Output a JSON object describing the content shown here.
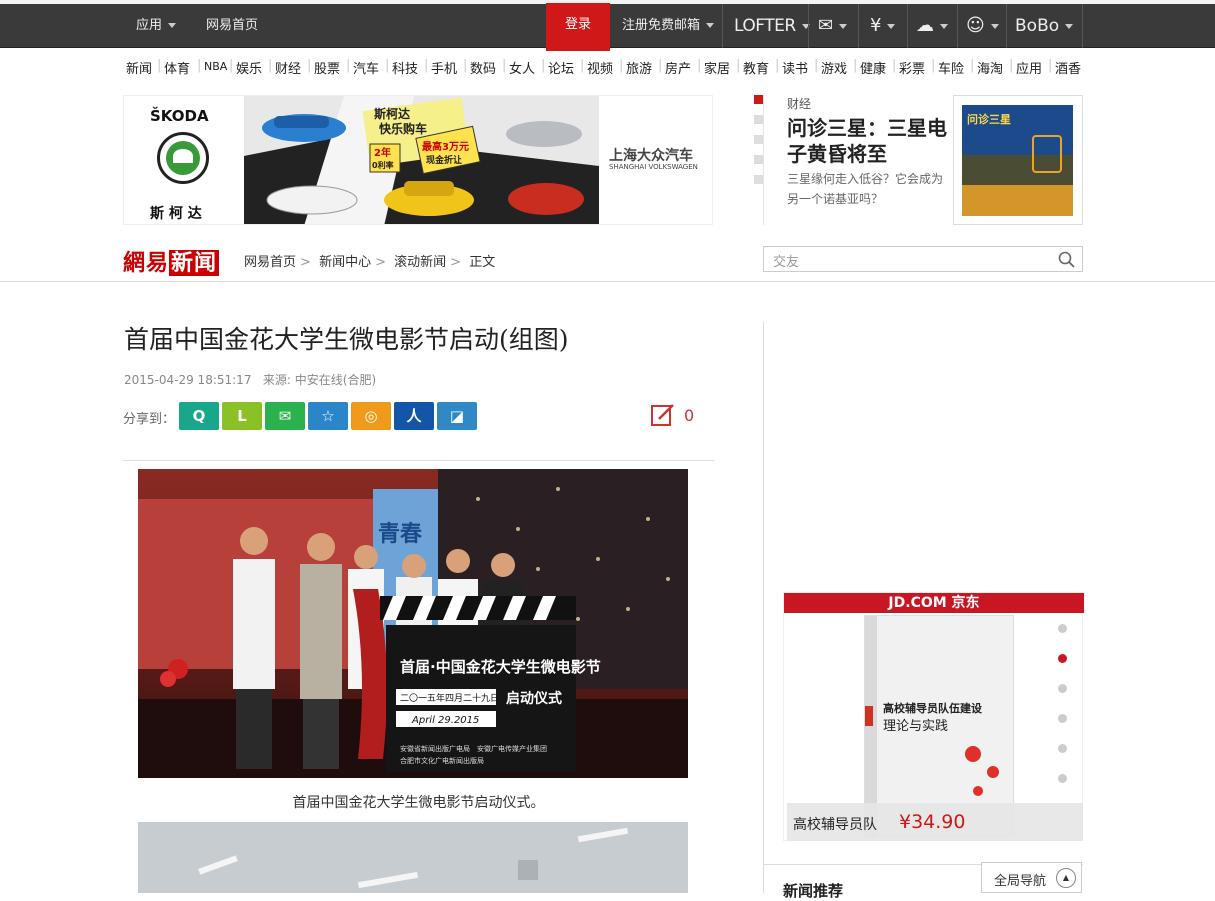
{
  "topbar": {
    "apps": "应用",
    "home": "网易首页",
    "login": "登录",
    "register": "注册免费邮箱",
    "lofter": "LOFTER",
    "bobo": "BoBo"
  },
  "nav": [
    "新闻",
    "体育",
    "NBA",
    "娱乐",
    "财经",
    "股票",
    "汽车",
    "科技",
    "手机",
    "数码",
    "女人",
    "论坛",
    "视频",
    "旅游",
    "房产",
    "家居",
    "教育",
    "读书",
    "游戏",
    "健康",
    "彩票",
    "车险",
    "海淘",
    "应用",
    "酒香"
  ],
  "ad": {
    "brand": "ŠKODA",
    "brand_cn": "斯 柯 达",
    "slogan1": "斯柯达",
    "slogan2": "快乐购车",
    "rate": "2年",
    "rate2": "0利率",
    "cash": "最高3万元",
    "cash2": "现金折让",
    "dealer_cn": "上海大众汽车",
    "dealer_en": "SHANGHAI VOLKSWAGEN"
  },
  "finance": {
    "tag": "财经",
    "headline": "问诊三星：三星电子黄昏将至",
    "sub": "三星缘何走入低谷？它会成为另一个诺基亚吗？",
    "thumb_text": "问诊三星"
  },
  "breadcrumb": {
    "logo1": "網易",
    "logo2": "新闻",
    "items": [
      "网易首页",
      "新闻中心",
      "滚动新闻",
      "正文"
    ]
  },
  "search": {
    "placeholder": "交友"
  },
  "article": {
    "title": "首届中国金花大学生微电影节启动(组图)",
    "date": "2015-04-29 18:51:17",
    "source": "来源: 中安在线(合肥)",
    "share_label": "分享到：",
    "comment_count": "0",
    "caption1": "首届中国金花大学生微电影节启动仪式。",
    "board_title": "首届·中国金花大学生微电影节",
    "board_date": "二〇一五年四月二十九日",
    "board_ceremony": "启动仪式",
    "board_en": "April 29.2015",
    "board_org1": "安徽省新闻出版广电局　安徽广电传媒产业集团",
    "board_org2": "合肥市文化广电新闻出版局",
    "bg_text": "青春"
  },
  "share_buttons": [
    {
      "name": "qzone",
      "glyph": "Q",
      "color": "#1aa68a"
    },
    {
      "name": "line",
      "glyph": "L",
      "color": "#89c127"
    },
    {
      "name": "wechat",
      "glyph": "✉",
      "color": "#2bb24c"
    },
    {
      "name": "star",
      "glyph": "☆",
      "color": "#2b86c9"
    },
    {
      "name": "weibo",
      "glyph": "◎",
      "color": "#f09a1b"
    },
    {
      "name": "renren",
      "glyph": "人",
      "color": "#1356a8"
    },
    {
      "name": "note",
      "glyph": "◪",
      "color": "#2e89c6"
    }
  ],
  "jd": {
    "header": "JD.COM 京东",
    "book_title": "高校辅导员队伍建设",
    "book_sub": "理论与实践",
    "product": "高校辅导员队",
    "price": "¥34.90",
    "active_dot": 1
  },
  "sidebar": {
    "global_nav": "全局导航",
    "news_rec": "新闻推荐"
  }
}
